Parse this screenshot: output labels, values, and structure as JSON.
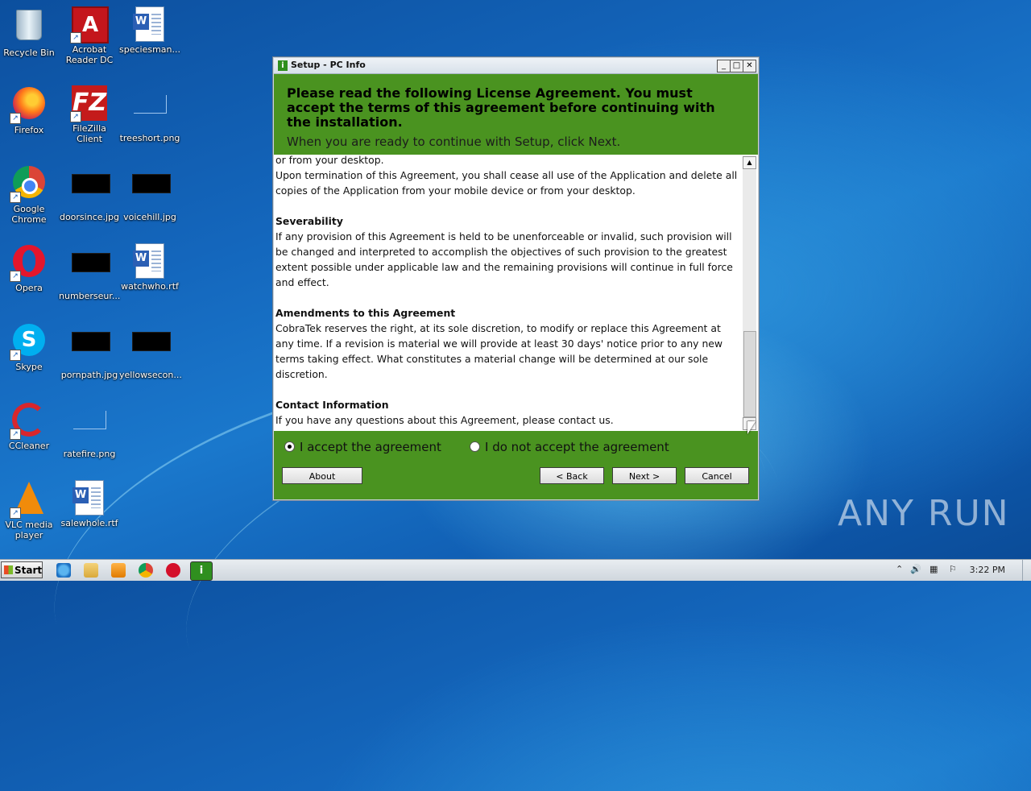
{
  "desktop": {
    "icons": [
      {
        "label": "Recycle Bin"
      },
      {
        "label": "Acrobat Reader DC"
      },
      {
        "label": "speciesman..."
      },
      {
        "label": "Firefox"
      },
      {
        "label": "FileZilla Client"
      },
      {
        "label": "treeshort.png"
      },
      {
        "label": "Google Chrome"
      },
      {
        "label": "doorsince.jpg"
      },
      {
        "label": "voicehill.jpg"
      },
      {
        "label": "Opera"
      },
      {
        "label": "numberseur..."
      },
      {
        "label": "watchwho.rtf"
      },
      {
        "label": "Skype"
      },
      {
        "label": "pornpath.jpg"
      },
      {
        "label": "yellowsecon..."
      },
      {
        "label": "CCleaner"
      },
      {
        "label": "ratefire.png"
      },
      {
        "label": "VLC media player"
      },
      {
        "label": "salewhole.rtf"
      }
    ]
  },
  "window": {
    "title": "Setup - PC Info",
    "controls": {
      "minimize": "_",
      "maximize": "□",
      "close": "✕"
    },
    "header": {
      "heading": "Please read the following License Agreement. You must accept the terms of this agreement before continuing with the installation.",
      "subtext": "When you are ready to continue with Setup, click Next."
    },
    "license": {
      "p1": "or from your desktop.",
      "p2": "Upon termination of this Agreement, you shall cease all use of the Application and delete all copies of the Application from your mobile device or from your desktop.",
      "h_severability": "Severability",
      "p_severability": "If any provision of this Agreement is held to be unenforceable or invalid, such provision will be changed and interpreted to accomplish the objectives of such provision to the greatest extent possible under applicable law and the remaining provisions will continue in full force and effect.",
      "h_amendments": "Amendments to this Agreement",
      "p_amendments": "CobraTek reserves the right, at its sole discretion, to modify or replace this Agreement at any time. If a revision is material we will provide at least 30 days' notice prior to any new terms taking effect. What constitutes a material change will be determined at our sole discretion.",
      "h_contact": "Contact Information",
      "p_contact": "If you have any questions about this Agreement, please contact us."
    },
    "radios": {
      "accept": "I accept the agreement",
      "decline": "I do not accept the agreement",
      "selected": "accept"
    },
    "buttons": {
      "about": "About",
      "back": "< Back",
      "next": "Next >",
      "cancel": "Cancel"
    }
  },
  "taskbar": {
    "start_label": "Start",
    "clock": "3:22 PM"
  },
  "watermark": "ANY RUN",
  "colors": {
    "installer_green": "#4a9320",
    "desktop_blue": "#1467bd"
  }
}
